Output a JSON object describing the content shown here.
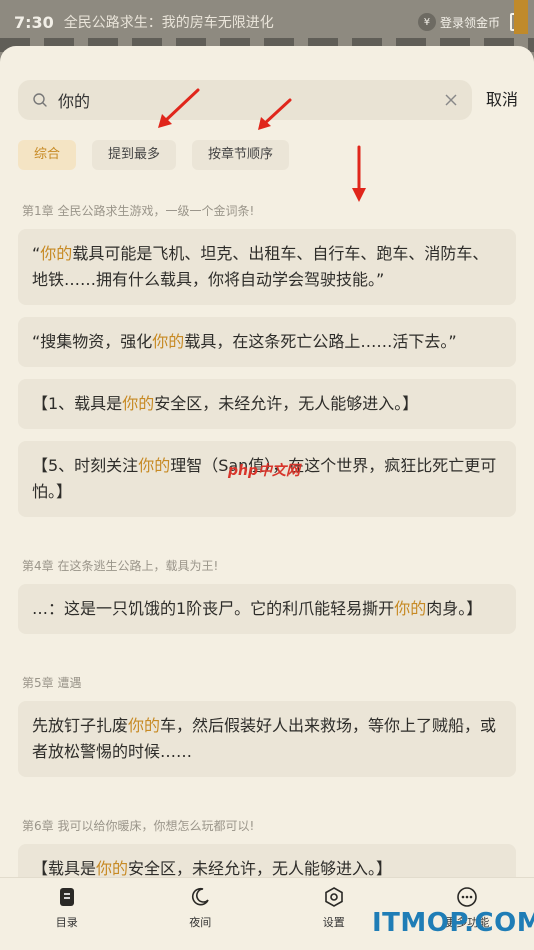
{
  "background": {
    "time": "7:30",
    "book_title": "全民公路求生：我的房车无限进化",
    "coin_label": "登录领金币"
  },
  "search": {
    "query": "你的",
    "cancel_label": "取消"
  },
  "tabs": [
    {
      "label": "综合",
      "active": true
    },
    {
      "label": "提到最多",
      "active": false
    },
    {
      "label": "按章节顺序",
      "active": false
    }
  ],
  "results": [
    {
      "chapter": "第1章 全民公路求生游戏，一级一个金词条!",
      "cards": [
        {
          "before": "“",
          "hl": "你的",
          "after": "载具可能是飞机、坦克、出租车、自行车、跑车、消防车、地铁……拥有什么载具，你将自动学会驾驶技能。”"
        },
        {
          "before": "“搜集物资，强化",
          "hl": "你的",
          "after": "载具，在这条死亡公路上……活下去。”"
        },
        {
          "before": "【1、载具是",
          "hl": "你的",
          "after": "安全区，未经允许，无人能够进入。】"
        },
        {
          "before": "【5、时刻关注",
          "hl": "你的",
          "after": "理智（San值），在这个世界，疯狂比死亡更可怕。】"
        }
      ]
    },
    {
      "chapter": "第4章 在这条逃生公路上，载具为王!",
      "cards": [
        {
          "before": "…：这是一只饥饿的1阶丧尸。它的利爪能轻易撕开",
          "hl": "你的",
          "after": "肉身。】"
        }
      ]
    },
    {
      "chapter": "第5章 遭遇",
      "cards": [
        {
          "before": "先放钉子扎废",
          "hl": "你的",
          "after": "车，然后假装好人出来救场，等你上了贼船，或者放松警惕的时候……"
        }
      ]
    },
    {
      "chapter": "第6章 我可以给你暖床，你想怎么玩都可以!",
      "cards": [
        {
          "before": "【载具是",
          "hl": "你的",
          "after": "安全区，未经允许，无人能够进入。】"
        }
      ]
    }
  ],
  "bottom_nav": [
    {
      "label": "目录",
      "icon": "catalog-icon"
    },
    {
      "label": "夜间",
      "icon": "moon-icon"
    },
    {
      "label": "设置",
      "icon": "settings-icon"
    },
    {
      "label": "更多功能",
      "icon": "more-icon"
    }
  ],
  "watermarks": {
    "center": "php中文网",
    "corner": "ITMOP.COM"
  },
  "colors": {
    "accent": "#c78a24",
    "arrow": "#e0261b",
    "sheet_bg": "#f4efe2",
    "card_bg": "#ebe5d7"
  }
}
